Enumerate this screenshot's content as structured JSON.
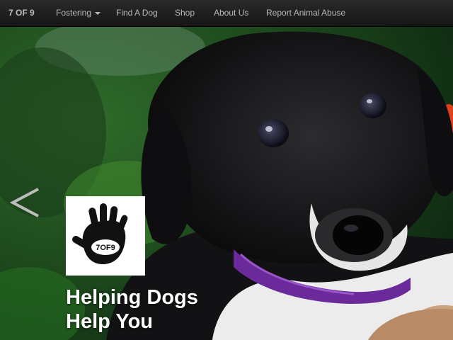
{
  "navbar": {
    "brand": "7 OF 9",
    "items": [
      {
        "label": "Fostering",
        "has_dropdown": true
      },
      {
        "label": "Find A Dog"
      },
      {
        "label": "Shop"
      },
      {
        "label": "About Us"
      },
      {
        "label": "Report Animal Abuse"
      }
    ]
  },
  "hero": {
    "headline_line1": "Helping Dogs",
    "headline_line2": "Help You",
    "prev_icon": "chevron-left-icon",
    "logo_icon": "handprint-logo-icon",
    "logo_text": "7OF9"
  },
  "colors": {
    "navbar_bg": "#1c1c1c",
    "nav_text": "#b8b8b8",
    "collar": "#6a2a9a",
    "headline": "#ffffff"
  }
}
